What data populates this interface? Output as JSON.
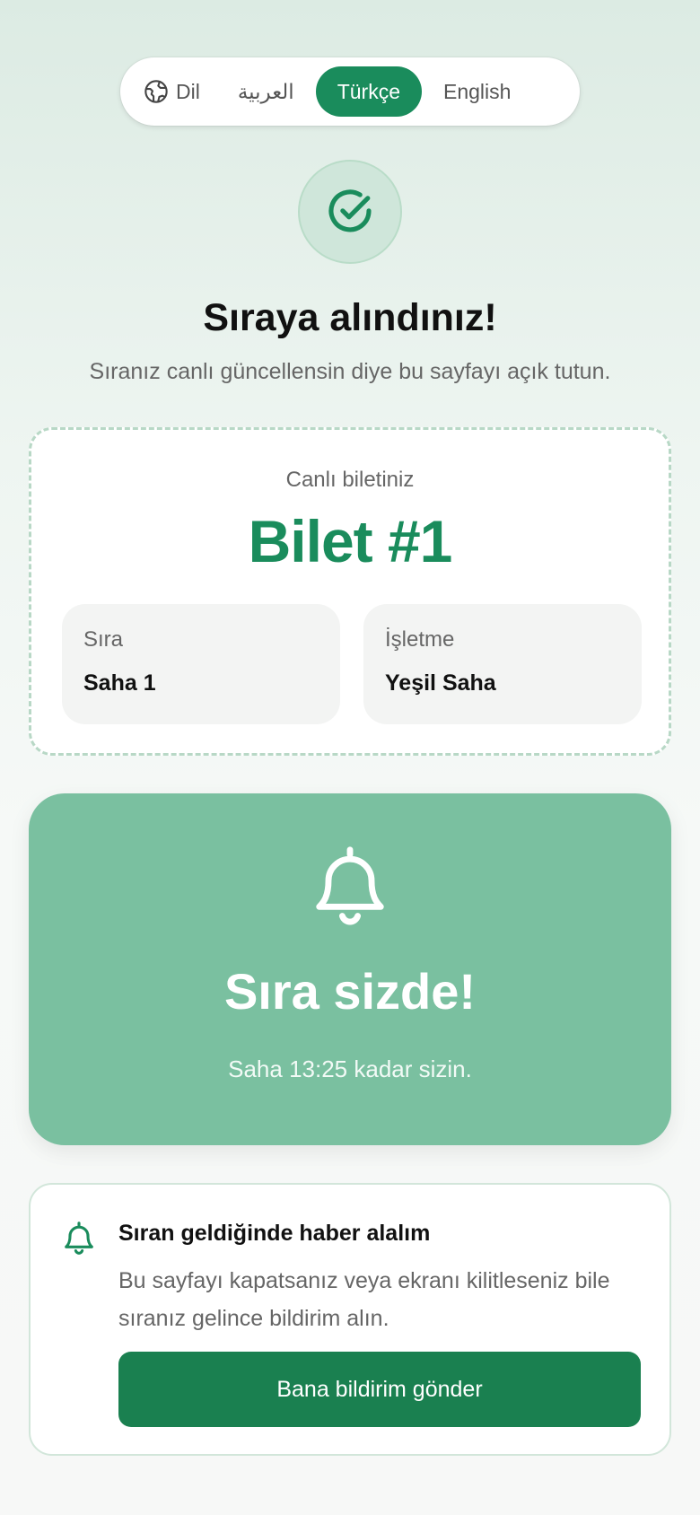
{
  "language": {
    "label": "Dil",
    "options": [
      {
        "label": "العربية",
        "active": false
      },
      {
        "label": "Türkçe",
        "active": true
      },
      {
        "label": "English",
        "active": false
      }
    ]
  },
  "header": {
    "title": "Sıraya alındınız!",
    "subtitle": "Sıranız canlı güncellensin diye bu sayfayı açık tutun."
  },
  "ticket": {
    "label": "Canlı biletiniz",
    "number": "Bilet #1",
    "queue_key": "Sıra",
    "queue_value": "Saha 1",
    "business_key": "İşletme",
    "business_value": "Yeşil Saha"
  },
  "turn": {
    "title": "Sıra sizde!",
    "subtitle": "Saha 13:25 kadar sizin."
  },
  "notify": {
    "title": "Sıran geldiğinde haber alalım",
    "description": "Bu sayfayı kapatsanız veya ekranı kilitleseniz bile sıranız gelince bildirim alın.",
    "button_label": "Bana bildirim gönder"
  },
  "colors": {
    "accent": "#1a8c5c",
    "turn_card": "#7ac0a0",
    "button": "#1a8050"
  }
}
